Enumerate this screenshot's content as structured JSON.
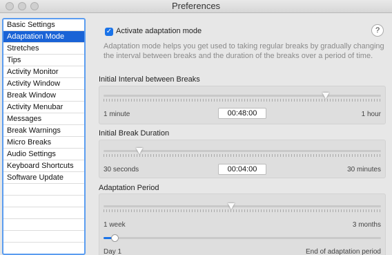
{
  "window": {
    "title": "Preferences"
  },
  "sidebar": {
    "items": [
      {
        "label": "Basic Settings"
      },
      {
        "label": "Adaptation Mode"
      },
      {
        "label": "Stretches"
      },
      {
        "label": "Tips"
      },
      {
        "label": "Activity Monitor"
      },
      {
        "label": "Activity Window"
      },
      {
        "label": "Break Window"
      },
      {
        "label": "Activity Menubar"
      },
      {
        "label": "Messages"
      },
      {
        "label": "Break Warnings"
      },
      {
        "label": "Micro Breaks"
      },
      {
        "label": "Audio Settings"
      },
      {
        "label": "Keyboard Shortcuts"
      },
      {
        "label": "Software Update"
      }
    ],
    "selected": "Adaptation Mode"
  },
  "adaptation": {
    "activate_checked": true,
    "activate_label": "Activate adaptation mode",
    "help_label": "?",
    "description": "Adaptation mode helps you get used to taking regular breaks by gradually changing the interval between breaks and the duration of the breaks over a period of time."
  },
  "interval": {
    "title": "Initial Interval between Breaks",
    "min_label": "1 minute",
    "max_label": "1 hour",
    "value": "00:48:00",
    "level": 0.8
  },
  "duration": {
    "title": "Initial Break Duration",
    "min_label": "30 seconds",
    "max_label": "30 minutes",
    "value": "00:04:00",
    "level": 0.13
  },
  "period": {
    "title": "Adaptation Period",
    "min_label": "1 week",
    "max_label": "3 months",
    "level": 0.46,
    "day_min_label": "Day 1",
    "day_max_label": "End of adaptation period",
    "day_level": 0.04
  },
  "colors": {
    "accent": "#1a73e8",
    "selection": "#1a63d6",
    "focus_ring": "#5a9cf0"
  }
}
